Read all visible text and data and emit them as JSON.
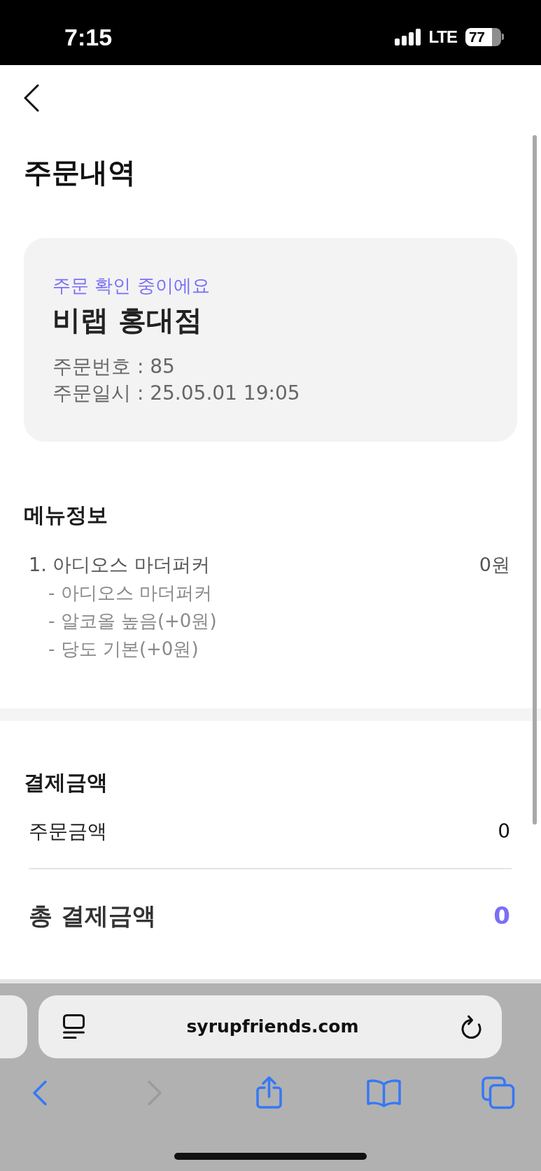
{
  "status_bar": {
    "time": "7:15",
    "network": "LTE",
    "battery": "77"
  },
  "header": {
    "title": "주문내역"
  },
  "order_card": {
    "status": "주문 확인 중이에요",
    "store": "비랩 홍대점",
    "order_number": "주문번호 : 85",
    "order_date": "주문일시 : 25.05.01 19:05"
  },
  "menu_info": {
    "heading": "메뉴정보",
    "items": [
      {
        "name": "1. 아디오스 마더퍼커",
        "price": "0원",
        "options": [
          "- 아디오스 마더퍼커",
          "- 알코올 높음(+0원)",
          "- 당도 기본(+0원)"
        ]
      }
    ]
  },
  "payment": {
    "heading": "결제금액",
    "rows": [
      {
        "kind": "subtotal",
        "label": "주문금액",
        "amount": "0"
      },
      {
        "kind": "total",
        "label": "총 결제금액",
        "amount": "0"
      }
    ]
  },
  "browser": {
    "url": "syrupfriends.com",
    "toolbar": [
      {
        "kind": "back",
        "disabled": false
      },
      {
        "kind": "forward",
        "disabled": true
      },
      {
        "kind": "share",
        "disabled": false
      },
      {
        "kind": "bookmarks",
        "disabled": false
      },
      {
        "kind": "tabs",
        "disabled": false
      }
    ]
  }
}
